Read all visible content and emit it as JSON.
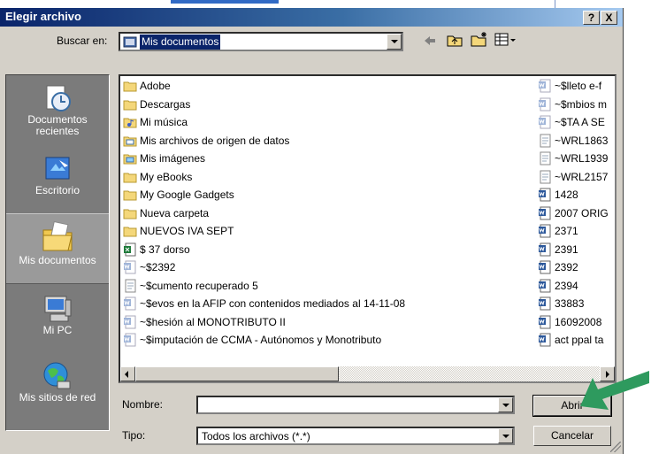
{
  "title": "Elegir archivo",
  "title_buttons": {
    "help": "?",
    "close": "X"
  },
  "lookin": {
    "label": "Buscar en:",
    "value": "Mis documentos"
  },
  "places": [
    {
      "label": "Documentos recientes",
      "icon": "recent-documents-icon"
    },
    {
      "label": "Escritorio",
      "icon": "desktop-icon"
    },
    {
      "label": "Mis documentos",
      "icon": "my-documents-icon",
      "selected": true
    },
    {
      "label": "Mi PC",
      "icon": "my-computer-icon"
    },
    {
      "label": "Mis sitios de red",
      "icon": "network-places-icon"
    }
  ],
  "files_col1": [
    {
      "name": "Adobe",
      "type": "folder"
    },
    {
      "name": "Descargas",
      "type": "folder"
    },
    {
      "name": "Mi música",
      "type": "music-folder"
    },
    {
      "name": "Mis archivos de origen de datos",
      "type": "data-folder"
    },
    {
      "name": "Mis imágenes",
      "type": "pictures-folder"
    },
    {
      "name": "My eBooks",
      "type": "folder"
    },
    {
      "name": "My Google Gadgets",
      "type": "folder"
    },
    {
      "name": "Nueva carpeta",
      "type": "folder"
    },
    {
      "name": "NUEVOS IVA SEPT",
      "type": "folder"
    },
    {
      "name": "$ 37 dorso",
      "type": "excel"
    },
    {
      "name": "~$2392",
      "type": "word-ghost"
    },
    {
      "name": "~$cumento recuperado 5",
      "type": "text"
    },
    {
      "name": "~$evos en la AFIP con contenidos mediados al 14-11-08",
      "type": "word-ghost"
    },
    {
      "name": "~$hesión al MONOTRIBUTO II",
      "type": "word-ghost"
    },
    {
      "name": "~$imputación de CCMA - Autónomos y Monotributo",
      "type": "word-ghost"
    }
  ],
  "files_col2": [
    {
      "name": "~$lleto e-f",
      "type": "word-ghost"
    },
    {
      "name": "~$mbios m",
      "type": "word-ghost"
    },
    {
      "name": "~$TA A SE",
      "type": "word-ghost"
    },
    {
      "name": "~WRL1863",
      "type": "text"
    },
    {
      "name": "~WRL1939",
      "type": "text"
    },
    {
      "name": "~WRL2157",
      "type": "text"
    },
    {
      "name": "1428",
      "type": "word"
    },
    {
      "name": "2007 ORIG",
      "type": "word"
    },
    {
      "name": "2371",
      "type": "word"
    },
    {
      "name": "2391",
      "type": "word"
    },
    {
      "name": "2392",
      "type": "word"
    },
    {
      "name": "2394",
      "type": "word"
    },
    {
      "name": "33883",
      "type": "word"
    },
    {
      "name": "16092008",
      "type": "word"
    },
    {
      "name": "act ppal ta",
      "type": "word"
    }
  ],
  "filename": {
    "label": "Nombre:",
    "value": ""
  },
  "filetype": {
    "label": "Tipo:",
    "value": "Todos los archivos (*.*)"
  },
  "buttons": {
    "open": "Abrir",
    "cancel": "Cancelar"
  },
  "annotation": {
    "color": "#2e9a5e",
    "target": "open-button"
  }
}
